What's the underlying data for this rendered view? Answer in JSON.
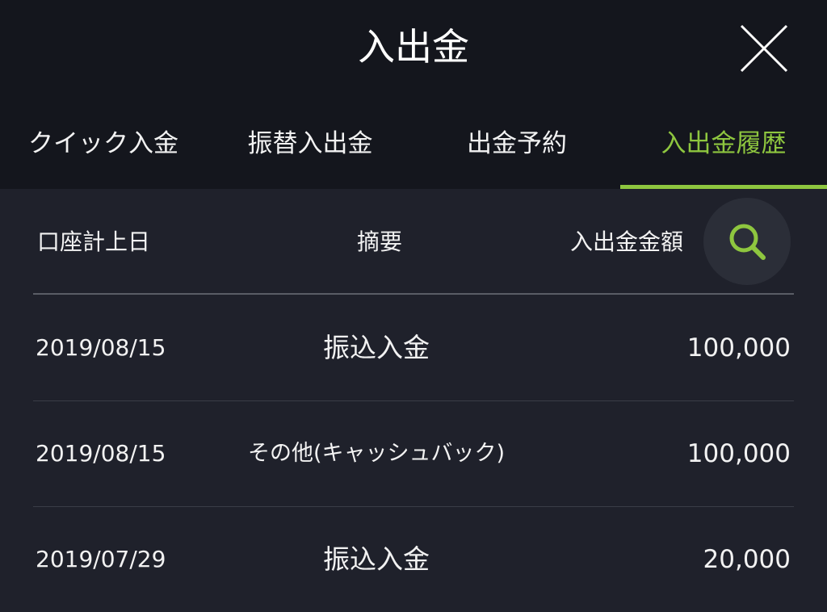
{
  "header": {
    "title": "入出金",
    "close_icon": "close-icon"
  },
  "tabs": [
    {
      "label": "クイック入金",
      "active": false
    },
    {
      "label": "振替入出金",
      "active": false
    },
    {
      "label": "出金予約",
      "active": false
    },
    {
      "label": "入出金履歴",
      "active": true
    }
  ],
  "colors": {
    "accent": "#8ec63f",
    "header_bg": "#14161d",
    "body_bg": "#1f212b"
  },
  "table": {
    "columns": {
      "date": "口座計上日",
      "description": "摘要",
      "amount": "入出金金額"
    },
    "search_icon": "search-icon",
    "rows": [
      {
        "date": "2019/08/15",
        "description": "振込入金",
        "amount": "100,000"
      },
      {
        "date": "2019/08/15",
        "description": "その他(キャッシュバック)",
        "amount": "100,000"
      },
      {
        "date": "2019/07/29",
        "description": "振込入金",
        "amount": "20,000"
      }
    ]
  }
}
